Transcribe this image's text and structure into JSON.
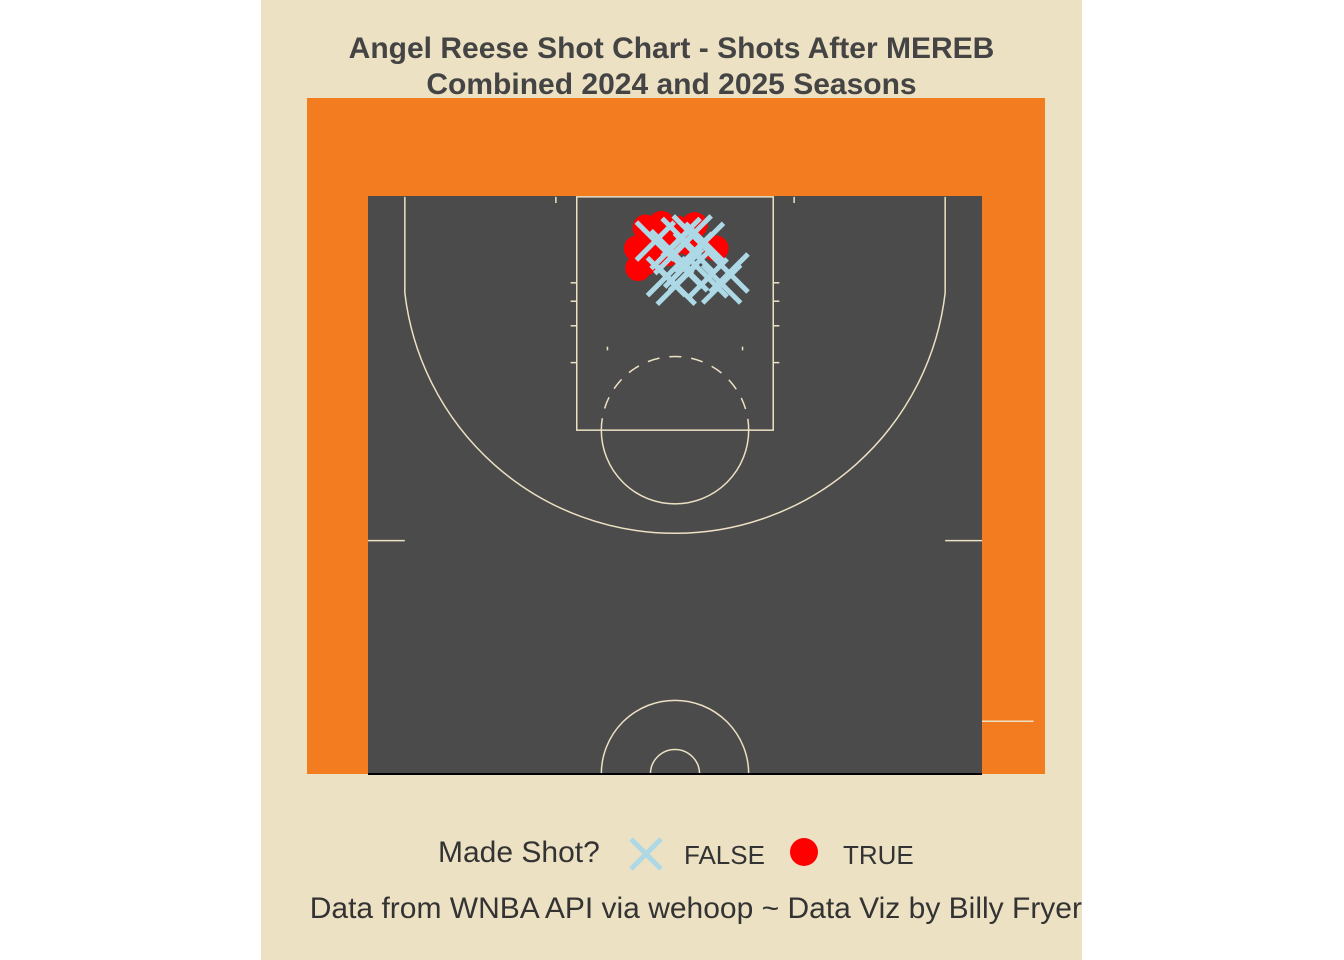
{
  "chart_data": {
    "type": "scatter",
    "title": "Angel Reese Shot Chart - Shots After MEREB",
    "subtitle": "Combined 2024 and 2025 Seasons",
    "caption": "Data from WNBA API via wehoop ~ Data Viz by Billy Fryer",
    "legend": {
      "title": "Made Shot?",
      "position": "bottom",
      "entries": [
        {
          "label": "FALSE",
          "marker": "x",
          "color": "#ADD8E6"
        },
        {
          "label": "TRUE",
          "marker": "circle",
          "color": "#FF0000"
        }
      ]
    },
    "colors": {
      "background": "#EDE1C4",
      "court_border": "#F47C20",
      "court": "#4B4B4B",
      "lines": "#EDE1C4",
      "made": "#FF0000",
      "missed": "#ADD8E6"
    },
    "axes": {
      "x_range_ft": [
        -25,
        25
      ],
      "y_range_ft": [
        0,
        47
      ],
      "grid": false
    },
    "series": [
      {
        "name": "TRUE",
        "x": [
          -2.4,
          -1.1,
          0.2,
          1.6,
          -3.1,
          -2.3,
          3.3,
          -0.6,
          1.1,
          -3.0,
          -1.9,
          -0.4
        ],
        "y": [
          44.5,
          44.8,
          44.4,
          44.7,
          42.8,
          41.7,
          42.8,
          42.4,
          43.3,
          41.2,
          42.9,
          43.9
        ]
      },
      {
        "name": "FALSE",
        "x": [
          -0.4,
          1.4,
          0.7,
          2.4,
          4.4,
          2.7,
          0.1,
          -0.1,
          1.1,
          -1.6,
          3.8,
          1.5,
          0.5,
          -0.7
        ],
        "y": [
          42.7,
          43.9,
          41.2,
          43.3,
          40.8,
          40.4,
          39.8,
          42.3,
          40.9,
          43.4,
          39.9,
          42.5,
          43.7,
          40.5
        ]
      }
    ]
  }
}
